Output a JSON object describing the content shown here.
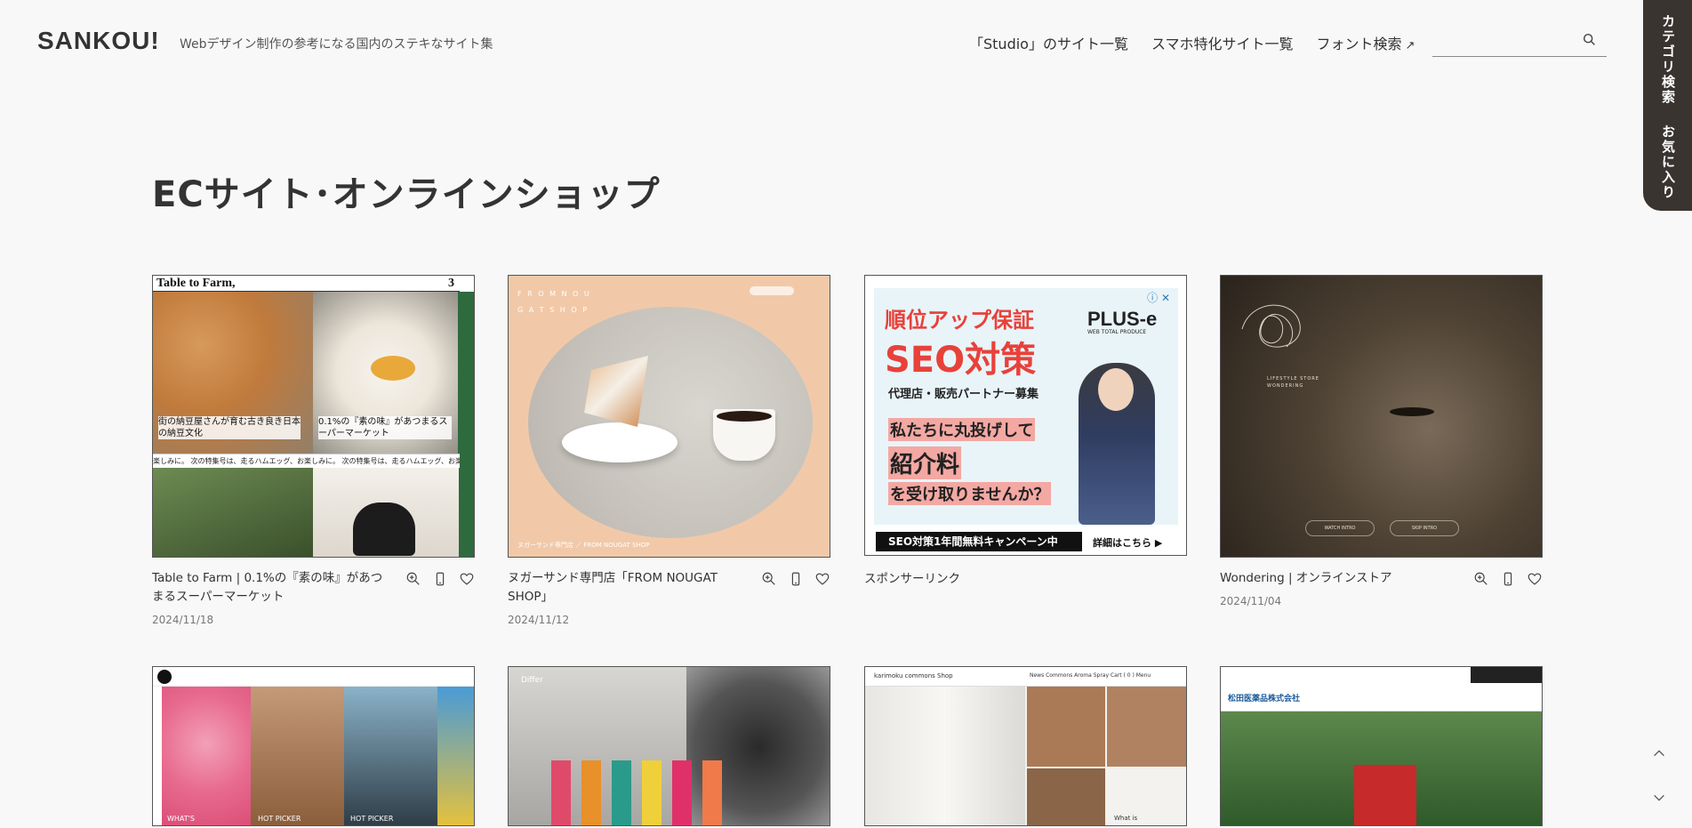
{
  "header": {
    "logo": "SANKOU!",
    "tagline": "Webデザイン制作の参考になる国内のステキなサイト集",
    "nav": [
      "「Studio」のサイト一覧",
      "スマホ特化サイト一覧",
      "フォント検索"
    ],
    "nav_external_icon": "↗",
    "search_placeholder": ""
  },
  "side_tab": {
    "category": "カテゴリ検索",
    "favorites": "お気に入り"
  },
  "page_title": "ECサイト･オンラインショップ",
  "cards": [
    {
      "title": "Table to Farm | 0.1%の『素の味』があつまるスーパーマーケット",
      "date": "2024/11/18",
      "thumb": {
        "brand": "Table to Farm,",
        "num": "3",
        "caption1": "街の納豆屋さんが育む古き良き日本の納豆文化",
        "caption2": "0.1%の『素の味』があつまるスーパーマーケット",
        "ticker": "楽しみに。 次の特集号は、走るハムエッグ、お楽しみに。 次の特集号は、走るハムエッグ、お楽しみに。"
      }
    },
    {
      "title": "ヌガーサンド専門店「FROM NOUGAT SHOP」",
      "date": "2024/11/12",
      "thumb": {
        "logo": "F R O M  N O U G A T  S H O P",
        "footer": "ヌガーサンド専門店 ／ FROM NOUGAT SHOP"
      }
    },
    {
      "sponsor_label": "スポンサーリンク",
      "ad": {
        "line1": "順位アップ保証",
        "line2": "SEO対策",
        "line3": "代理店・販売パートナー募集",
        "line4": "私たちに丸投げして",
        "line5": "紹介料",
        "line6": "を受け取りませんか？",
        "cta": "SEO対策1年間無料キャンペーン中",
        "more": "詳細はこちら ▶",
        "brand": "PLUS-e",
        "brand_sub": "WEB TOTAL PRODUCE"
      }
    },
    {
      "title": "Wondering | オンラインストア",
      "date": "2024/11/04",
      "thumb": {
        "tag": "LIFESTYLE STORE WONDERING",
        "btn1": "WATCH INTRO",
        "btn2": "SKIP INTRO"
      }
    },
    {
      "thumb": {
        "label1": "WHAT'S",
        "label2": "HOT PICKER",
        "label3": "HOT PICKER"
      }
    },
    {
      "thumb": {
        "brand": "Differ"
      }
    },
    {
      "thumb": {
        "brand": "karimoku commons Shop",
        "nav": "News   Commons Aroma Spray   Cart ( 0 )   Menu",
        "caption": "What is"
      }
    },
    {
      "thumb": {
        "brand": "松田医薬品株式会社"
      }
    }
  ],
  "colors": {
    "background": "#f8f8f8",
    "side_tab": "#3a3431",
    "ad_red": "#e8413a"
  }
}
